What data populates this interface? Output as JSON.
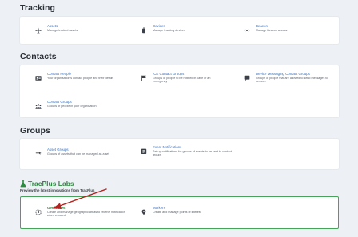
{
  "tracking": {
    "heading": "Tracking",
    "items": [
      {
        "label": "Assets",
        "description": "Manage tracked assets",
        "icon": "airplane-icon"
      },
      {
        "label": "Devices",
        "description": "Manage tracking devices",
        "icon": "device-icon"
      },
      {
        "label": "Beacon",
        "description": "Manage Beacon access",
        "icon": "beacon-icon"
      }
    ]
  },
  "contacts": {
    "heading": "Contacts",
    "items": [
      {
        "label": "Contact People",
        "description": "Your organisation's contact people and their details",
        "icon": "contact-card-icon"
      },
      {
        "label": "ICE Contact Groups",
        "description": "Groups of people to be notified in case of an emergency",
        "icon": "flag-icon"
      },
      {
        "label": "Device Messaging Contact Groups",
        "description": "Groups of people that are allowed to send messages to devices",
        "icon": "message-icon"
      },
      {
        "label": "Contact Groups",
        "description": "Groups of people in your organisation",
        "icon": "people-group-icon"
      }
    ]
  },
  "groups": {
    "heading": "Groups",
    "items": [
      {
        "label": "Asset Groups",
        "description": "Groups of assets that can be managed as a set",
        "icon": "airplane-group-icon"
      },
      {
        "label": "Event Notifications",
        "description": "Set up notifications for groups of events to be sent to contact groups",
        "icon": "notification-icon"
      }
    ]
  },
  "labs": {
    "brand": "TracPlus Labs",
    "subtitle": "Preview the latest innovations from TracPlus",
    "items": [
      {
        "label": "Geofences",
        "description": "Create and manage geographic areas to receive notification when crossed",
        "icon": "geofence-icon"
      },
      {
        "label": "Markers",
        "description": "Create and manage points of interest",
        "icon": "marker-icon"
      }
    ]
  },
  "colors": {
    "link": "#2f6fc2",
    "labs_green": "#2c8a3f",
    "arrow_red": "#b3231f",
    "background": "#edf1f6"
  }
}
